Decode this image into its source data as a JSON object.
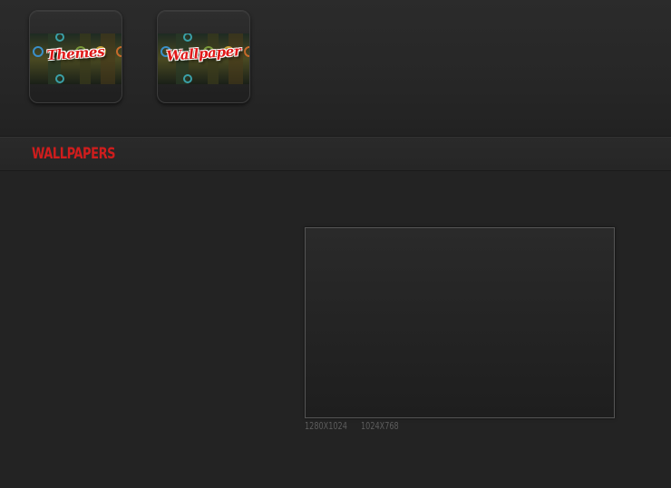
{
  "tiles": [
    {
      "label": "Themes",
      "ring_colors": [
        "#3a8fc8",
        "#3aa0a8",
        "#7a9a3a",
        "#c8a23a",
        "#c86a2a"
      ]
    },
    {
      "label": "Wallpaper",
      "ring_colors": [
        "#3a8fc8",
        "#3aa0a8",
        "#7a9a3a",
        "#c8a23a",
        "#c86a2a"
      ]
    }
  ],
  "section": {
    "title": "WALLPAPERS"
  },
  "resolutions": [
    "1280X1024",
    "1024X768"
  ],
  "colors": {
    "accent": "#cf1d1d",
    "background": "#232323"
  }
}
